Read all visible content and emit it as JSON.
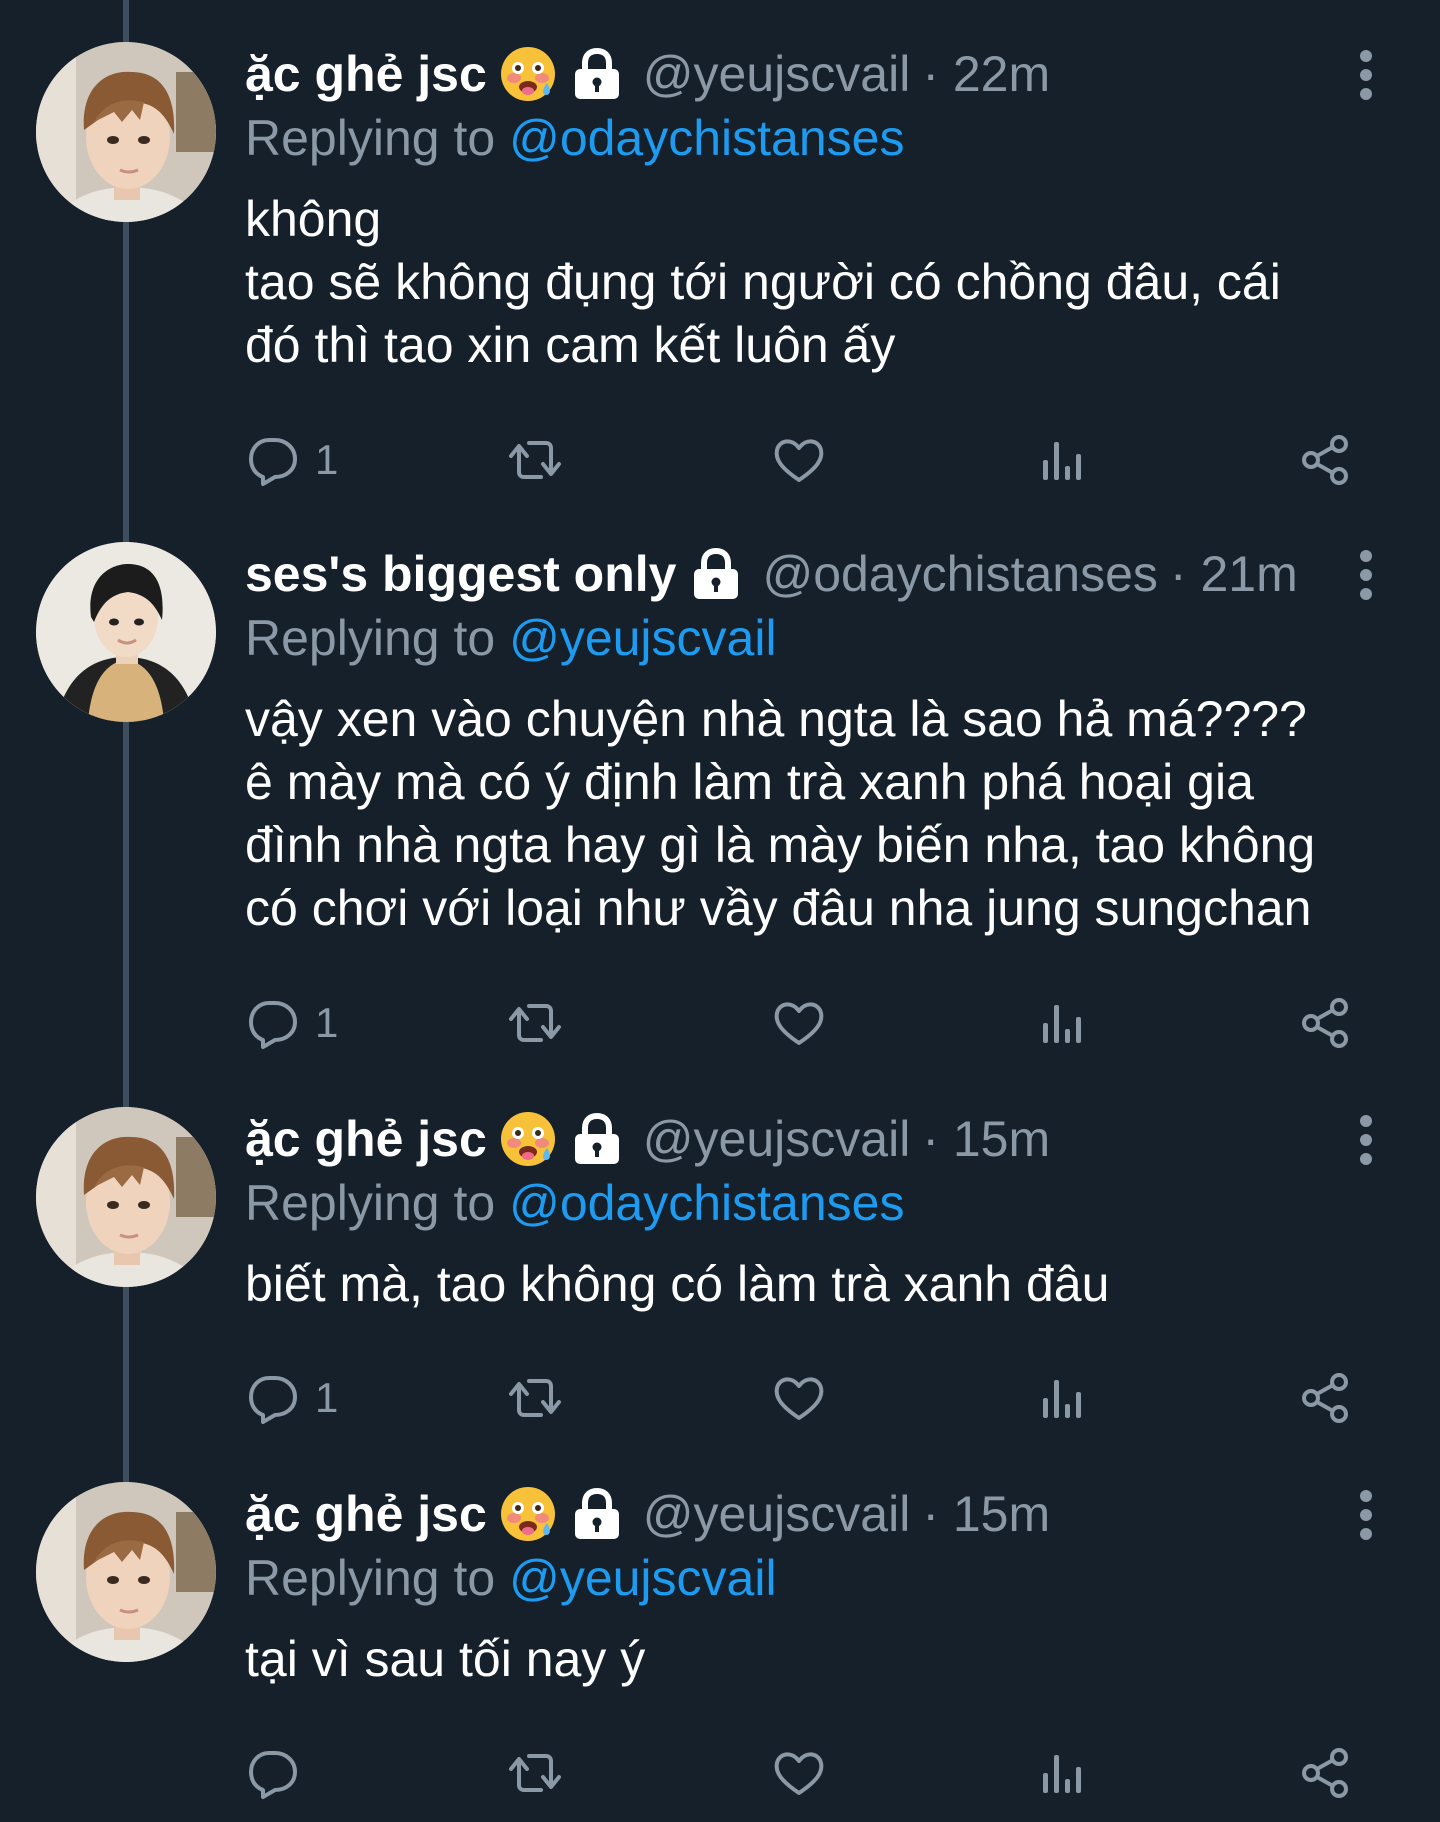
{
  "tweets": [
    {
      "name": "ặc ghẻ jsc",
      "handle": "@yeujscvail",
      "time": "· 22m",
      "replying_label": "Replying to",
      "replying_to": "@odaychistanses",
      "text": "không\ntao sẽ không đụng tới người có chồng đâu, cái\nđó thì tao xin cam kết luôn ấy",
      "reply_count": "1",
      "avatar": "avatar-jsc",
      "emoji": "flushed-drool-emoji",
      "locked": true
    },
    {
      "name": "ses's biggest only",
      "handle": "@odaychistanses",
      "time": "· 21m",
      "replying_label": "Replying to",
      "replying_to": "@yeujscvail",
      "text": "vậy xen vào chuyện nhà ngta là sao hả má????\nê mày mà có ý định làm trà xanh phá hoại gia\nđình nhà ngta hay gì là mày biến nha, tao không\ncó chơi với loại như vầy đâu nha jung sungchan",
      "reply_count": "1",
      "avatar": "avatar-ses",
      "locked": true
    },
    {
      "name": "ặc ghẻ jsc",
      "handle": "@yeujscvail",
      "time": "· 15m",
      "replying_label": "Replying to",
      "replying_to": "@odaychistanses",
      "text": "biết mà, tao không có làm trà xanh đâu",
      "reply_count": "1",
      "avatar": "avatar-jsc",
      "emoji": "flushed-drool-emoji",
      "locked": true
    },
    {
      "name": "ặc ghẻ jsc",
      "handle": "@yeujscvail",
      "time": "· 15m",
      "replying_label": "Replying to",
      "replying_to": "@yeujscvail",
      "text": "tại vì sau tối nay ý",
      "reply_count": "",
      "avatar": "avatar-jsc",
      "emoji": "flushed-drool-emoji",
      "locked": true
    }
  ],
  "colors": {
    "background": "#15202b",
    "text": "#ffffff",
    "muted": "#8b98a5",
    "link": "#1d9bf0",
    "thread_line": "#3d4f5f"
  }
}
